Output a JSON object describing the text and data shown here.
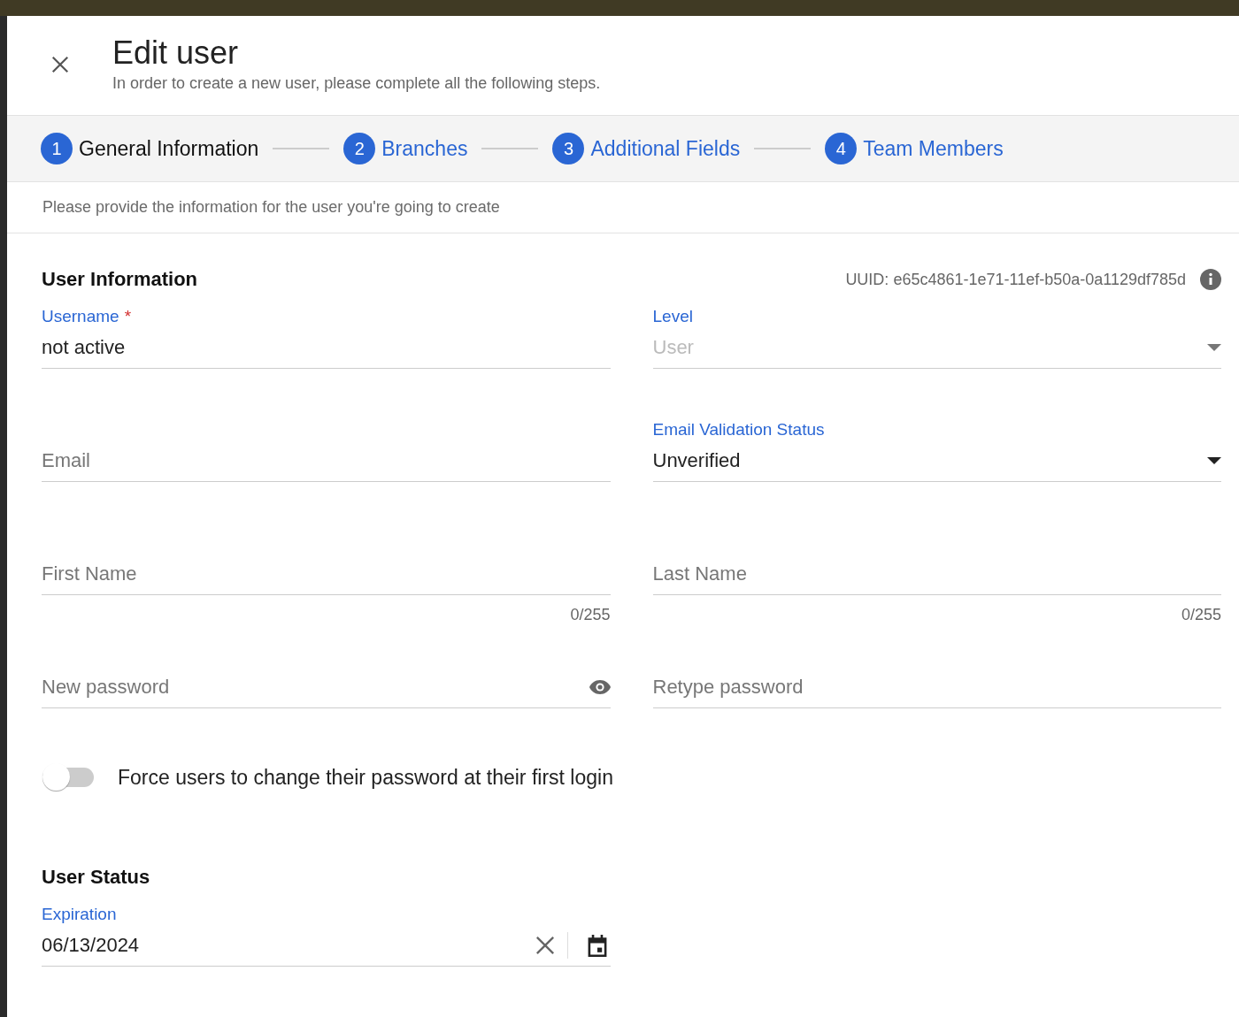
{
  "dialog": {
    "title": "Edit user",
    "subtitle": "In order to create a new user, please complete all the following steps."
  },
  "steps": [
    {
      "number": "1",
      "label": "General Information",
      "selected": true
    },
    {
      "number": "2",
      "label": "Branches",
      "selected": false
    },
    {
      "number": "3",
      "label": "Additional Fields",
      "selected": false
    },
    {
      "number": "4",
      "label": "Team Members",
      "selected": false
    }
  ],
  "instructions": "Please provide the information for the user you're going to create",
  "user_information": {
    "title": "User Information",
    "uuid": "UUID: e65c4861-1e71-11ef-b50a-0a1129df785d",
    "rows": [
      [
        {
          "kind": "text",
          "label": "Username",
          "required_mark": "*",
          "value": "not active"
        },
        {
          "kind": "select",
          "label": "Level",
          "value": "User",
          "disabled": true
        }
      ],
      [
        {
          "kind": "text",
          "placeholder": "Email"
        },
        {
          "kind": "select",
          "label": "Email Validation Status",
          "value": "Unverified",
          "disabled": false
        }
      ],
      [
        {
          "kind": "text",
          "placeholder": "First Name",
          "counter": "0/255"
        },
        {
          "kind": "text",
          "placeholder": "Last Name",
          "counter": "0/255"
        }
      ],
      [
        {
          "kind": "password",
          "placeholder": "New password"
        },
        {
          "kind": "text",
          "placeholder": "Retype password"
        }
      ]
    ],
    "force_change": {
      "label": "Force users to change their password at their first login",
      "on": false
    }
  },
  "user_status": {
    "title": "User Status",
    "rows": [
      [
        {
          "kind": "date",
          "label": "Expiration",
          "value": "06/13/2024"
        }
      ]
    ]
  }
}
